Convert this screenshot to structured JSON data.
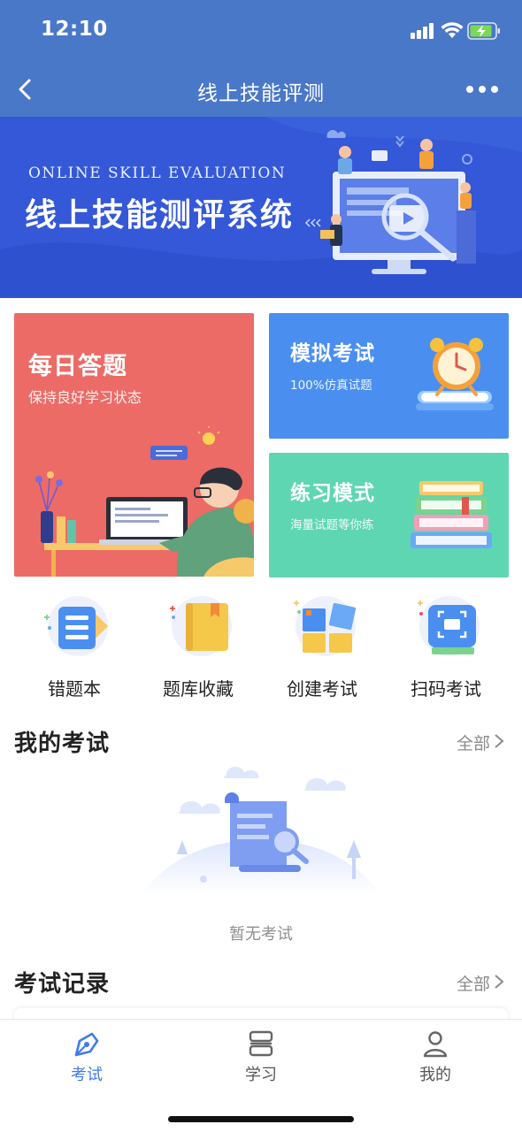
{
  "status_bar": {
    "time": "12:10"
  },
  "nav": {
    "title": "线上技能评测"
  },
  "banner": {
    "title_en": "ONLINE SKILL EVALUATION",
    "title_cn": "线上技能测评系统"
  },
  "cards": {
    "daily": {
      "title": "每日答题",
      "subtitle": "保持良好学习状态"
    },
    "mock": {
      "title": "模拟考试",
      "subtitle": "100%仿真试题"
    },
    "practice": {
      "title": "练习模式",
      "subtitle": "海量试题等你练"
    }
  },
  "quick_actions": [
    {
      "label": "错题本",
      "icon": "notebook-icon"
    },
    {
      "label": "题库收藏",
      "icon": "bookmark-book-icon"
    },
    {
      "label": "创建考试",
      "icon": "blocks-icon"
    },
    {
      "label": "扫码考试",
      "icon": "scan-icon"
    }
  ],
  "my_exams": {
    "title": "我的考试",
    "more_label": "全部",
    "empty_text": "暂无考试"
  },
  "exam_records": {
    "title": "考试记录",
    "more_label": "全部"
  },
  "tabs": [
    {
      "label": "考试",
      "icon": "pen-nib-icon",
      "active": true
    },
    {
      "label": "学习",
      "icon": "stack-icon",
      "active": false
    },
    {
      "label": "我的",
      "icon": "user-icon",
      "active": false
    }
  ],
  "colors": {
    "header": "#4a78c9",
    "banner": "#3257d6",
    "daily_card": "#ec6b66",
    "mock_card": "#4a8ff0",
    "practice_card": "#5fd6b2",
    "active_tab": "#3f7be8"
  }
}
